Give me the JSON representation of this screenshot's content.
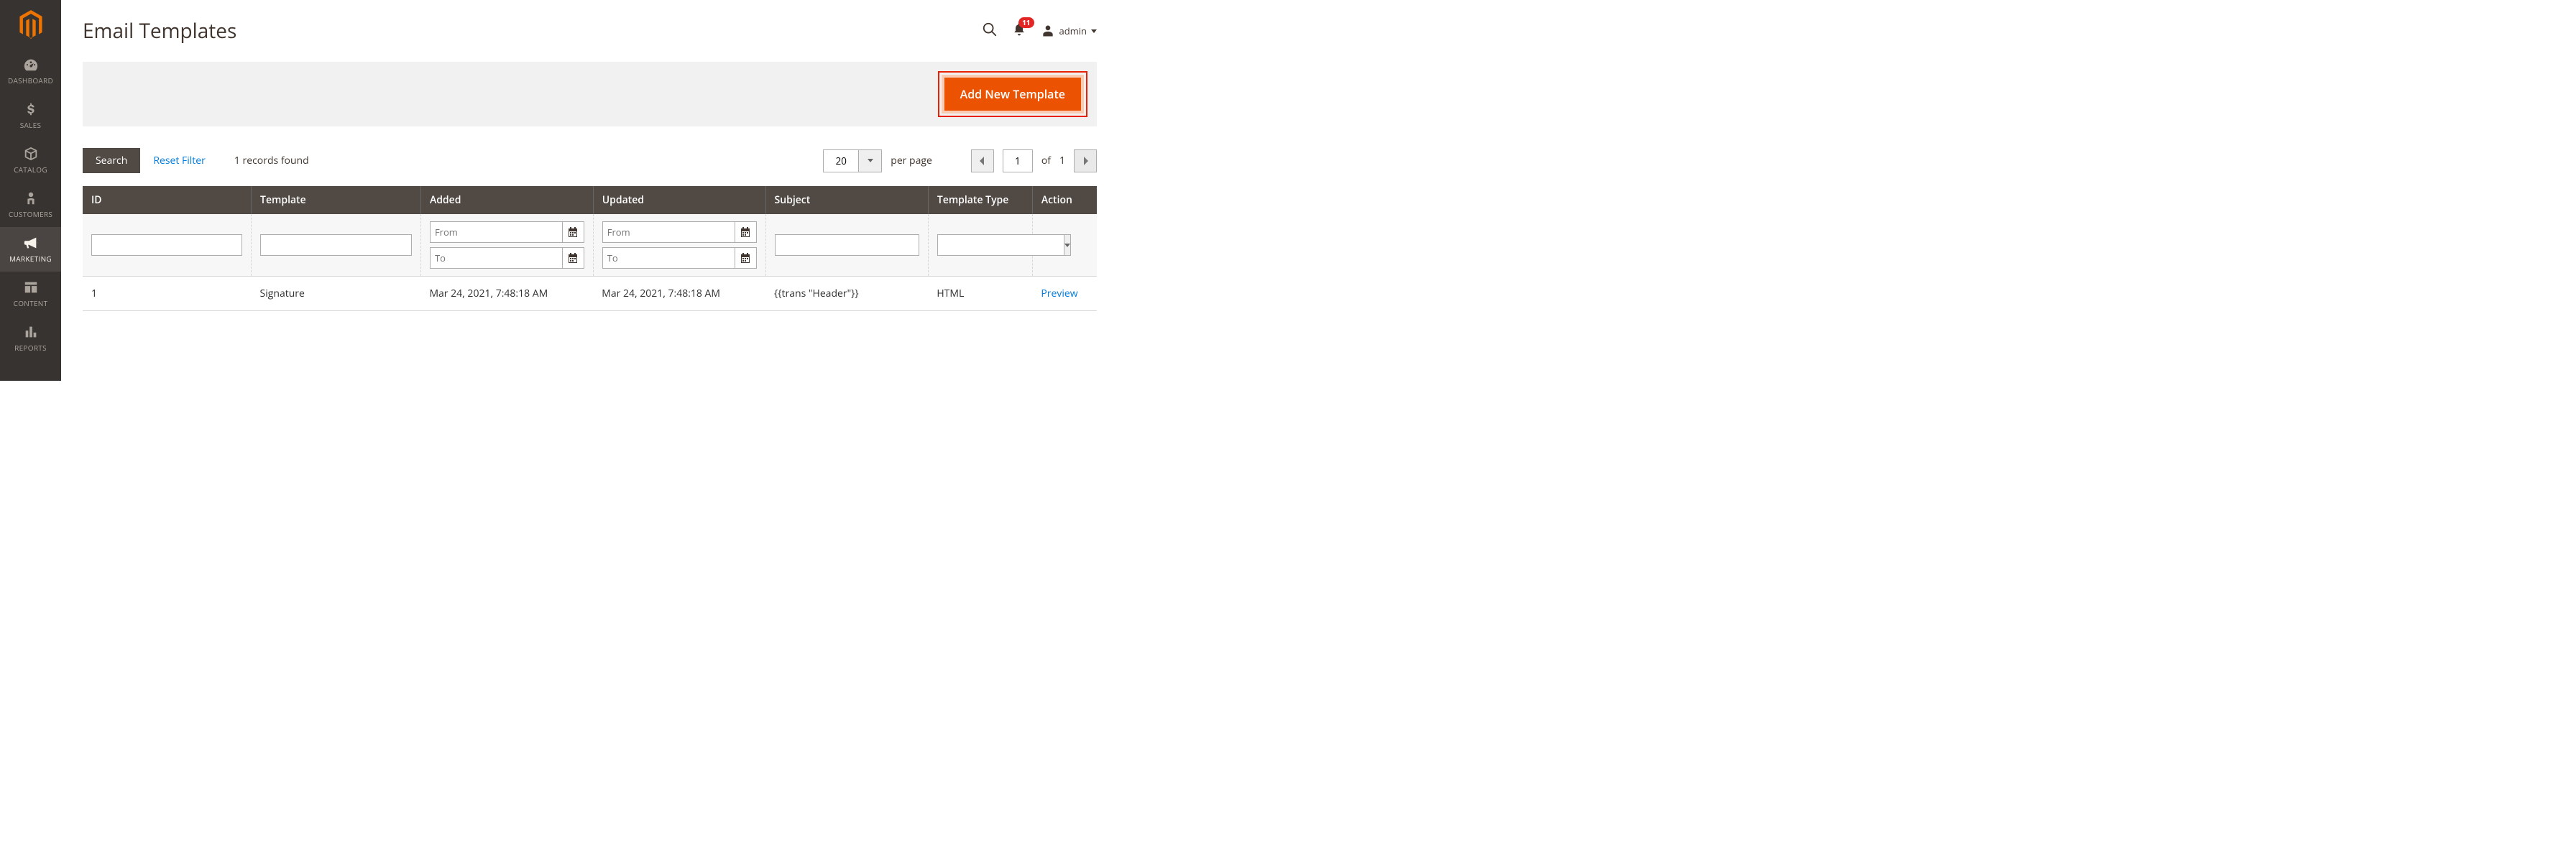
{
  "sidebar": {
    "items": [
      {
        "label": "DASHBOARD",
        "icon": "gauge-icon"
      },
      {
        "label": "SALES",
        "icon": "dollar-icon"
      },
      {
        "label": "CATALOG",
        "icon": "box-icon"
      },
      {
        "label": "CUSTOMERS",
        "icon": "person-icon"
      },
      {
        "label": "MARKETING",
        "icon": "megaphone-icon",
        "active": true
      },
      {
        "label": "CONTENT",
        "icon": "layout-icon"
      },
      {
        "label": "REPORTS",
        "icon": "bars-icon"
      }
    ]
  },
  "header": {
    "title": "Email Templates",
    "notifications_count": "11",
    "user_label": "admin"
  },
  "actions": {
    "add_new_label": "Add New Template"
  },
  "grid": {
    "search_label": "Search",
    "reset_label": "Reset Filter",
    "records_found": "1 records found",
    "page_size": "20",
    "per_page_label": "per page",
    "current_page": "1",
    "of_label": "of",
    "total_pages": "1",
    "columns": {
      "id": "ID",
      "template": "Template",
      "added": "Added",
      "updated": "Updated",
      "subject": "Subject",
      "type": "Template Type",
      "action": "Action"
    },
    "filters": {
      "date_from_placeholder": "From",
      "date_to_placeholder": "To"
    },
    "rows": [
      {
        "id": "1",
        "template": "Signature",
        "added": "Mar 24, 2021, 7:48:18 AM",
        "updated": "Mar 24, 2021, 7:48:18 AM",
        "subject": "{{trans \"Header\"}}",
        "type": "HTML",
        "action": "Preview"
      }
    ]
  }
}
